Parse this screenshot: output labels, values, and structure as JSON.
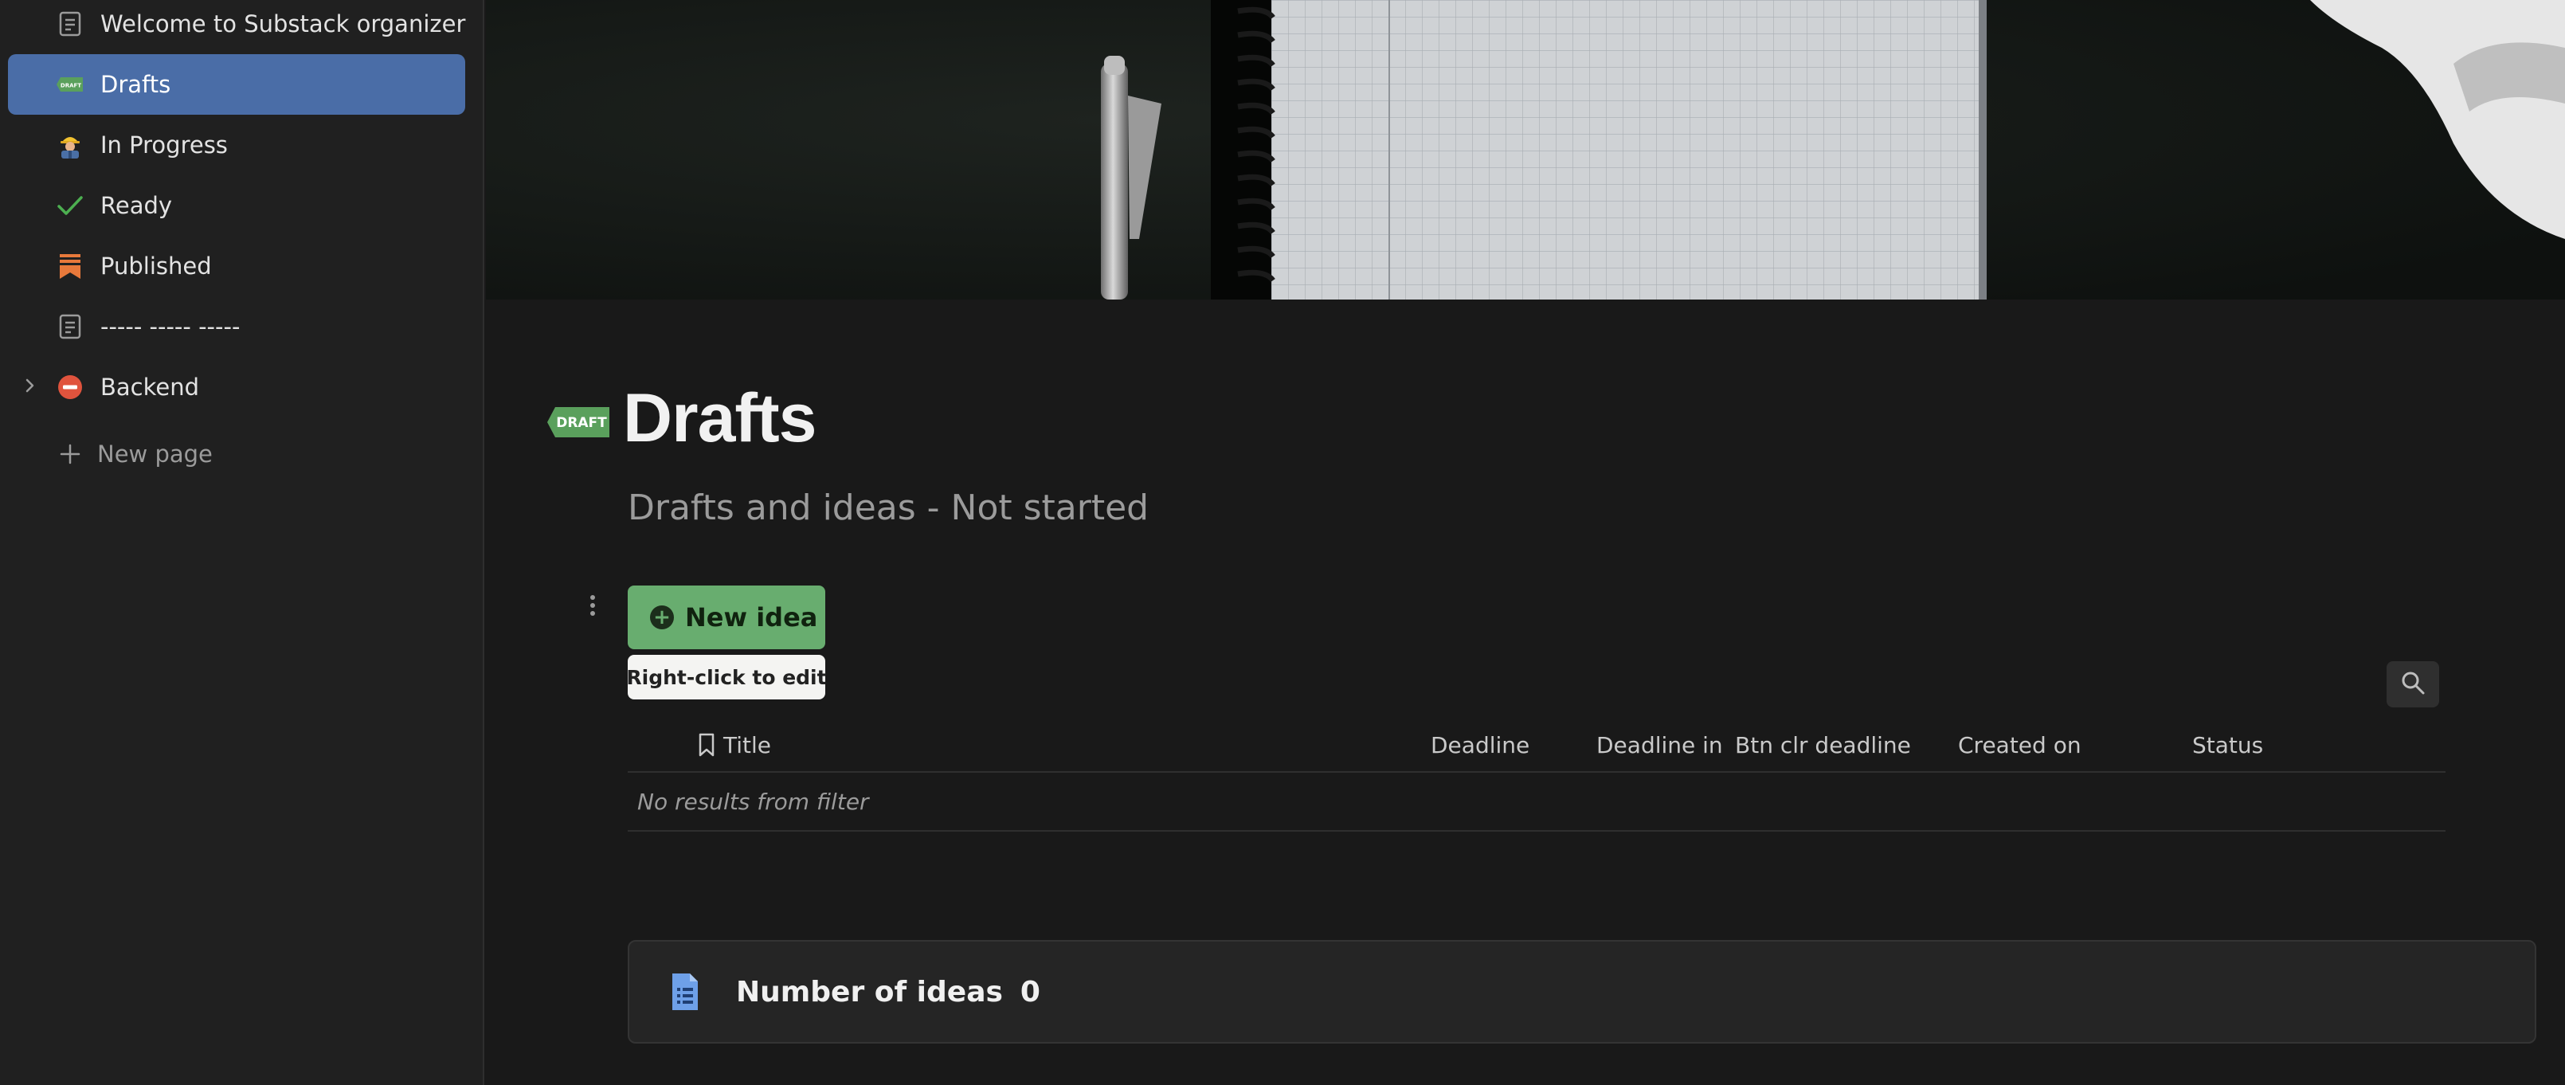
{
  "sidebar": {
    "items": [
      {
        "label": "Welcome to Substack organizer",
        "icon": "page-icon"
      },
      {
        "label": "Drafts",
        "icon": "draft-tag-icon",
        "active": true
      },
      {
        "label": "In Progress",
        "icon": "construction-worker-icon"
      },
      {
        "label": "Ready",
        "icon": "checkmark-icon"
      },
      {
        "label": "Published",
        "icon": "bookmark-icon"
      },
      {
        "label": "----- ----- -----",
        "icon": "page-icon"
      },
      {
        "label": "Backend",
        "icon": "no-entry-icon",
        "expandable": true
      }
    ],
    "new_page_label": "New page"
  },
  "page": {
    "title": "Drafts",
    "title_icon": "draft-tag-icon",
    "title_icon_text": "DRAFT",
    "subtitle": "Drafts and ideas - Not started"
  },
  "actions": {
    "new_button_label": "New idea",
    "tooltip": "Right-click to edit"
  },
  "table": {
    "columns": [
      "Title",
      "Deadline",
      "Deadline in",
      "Btn clr deadline",
      "Created on",
      "Status"
    ],
    "empty_message": "No results from filter"
  },
  "stat": {
    "label": "Number of ideas",
    "value": "0"
  },
  "colors": {
    "sidebar_bg": "#202020",
    "main_bg": "#191919",
    "active_item": "#4a6da7",
    "button_green": "#68ad6f",
    "draft_green": "#5aa05c",
    "published_orange": "#e8793b",
    "backend_red": "#e0533d",
    "check_green": "#4caf50"
  }
}
